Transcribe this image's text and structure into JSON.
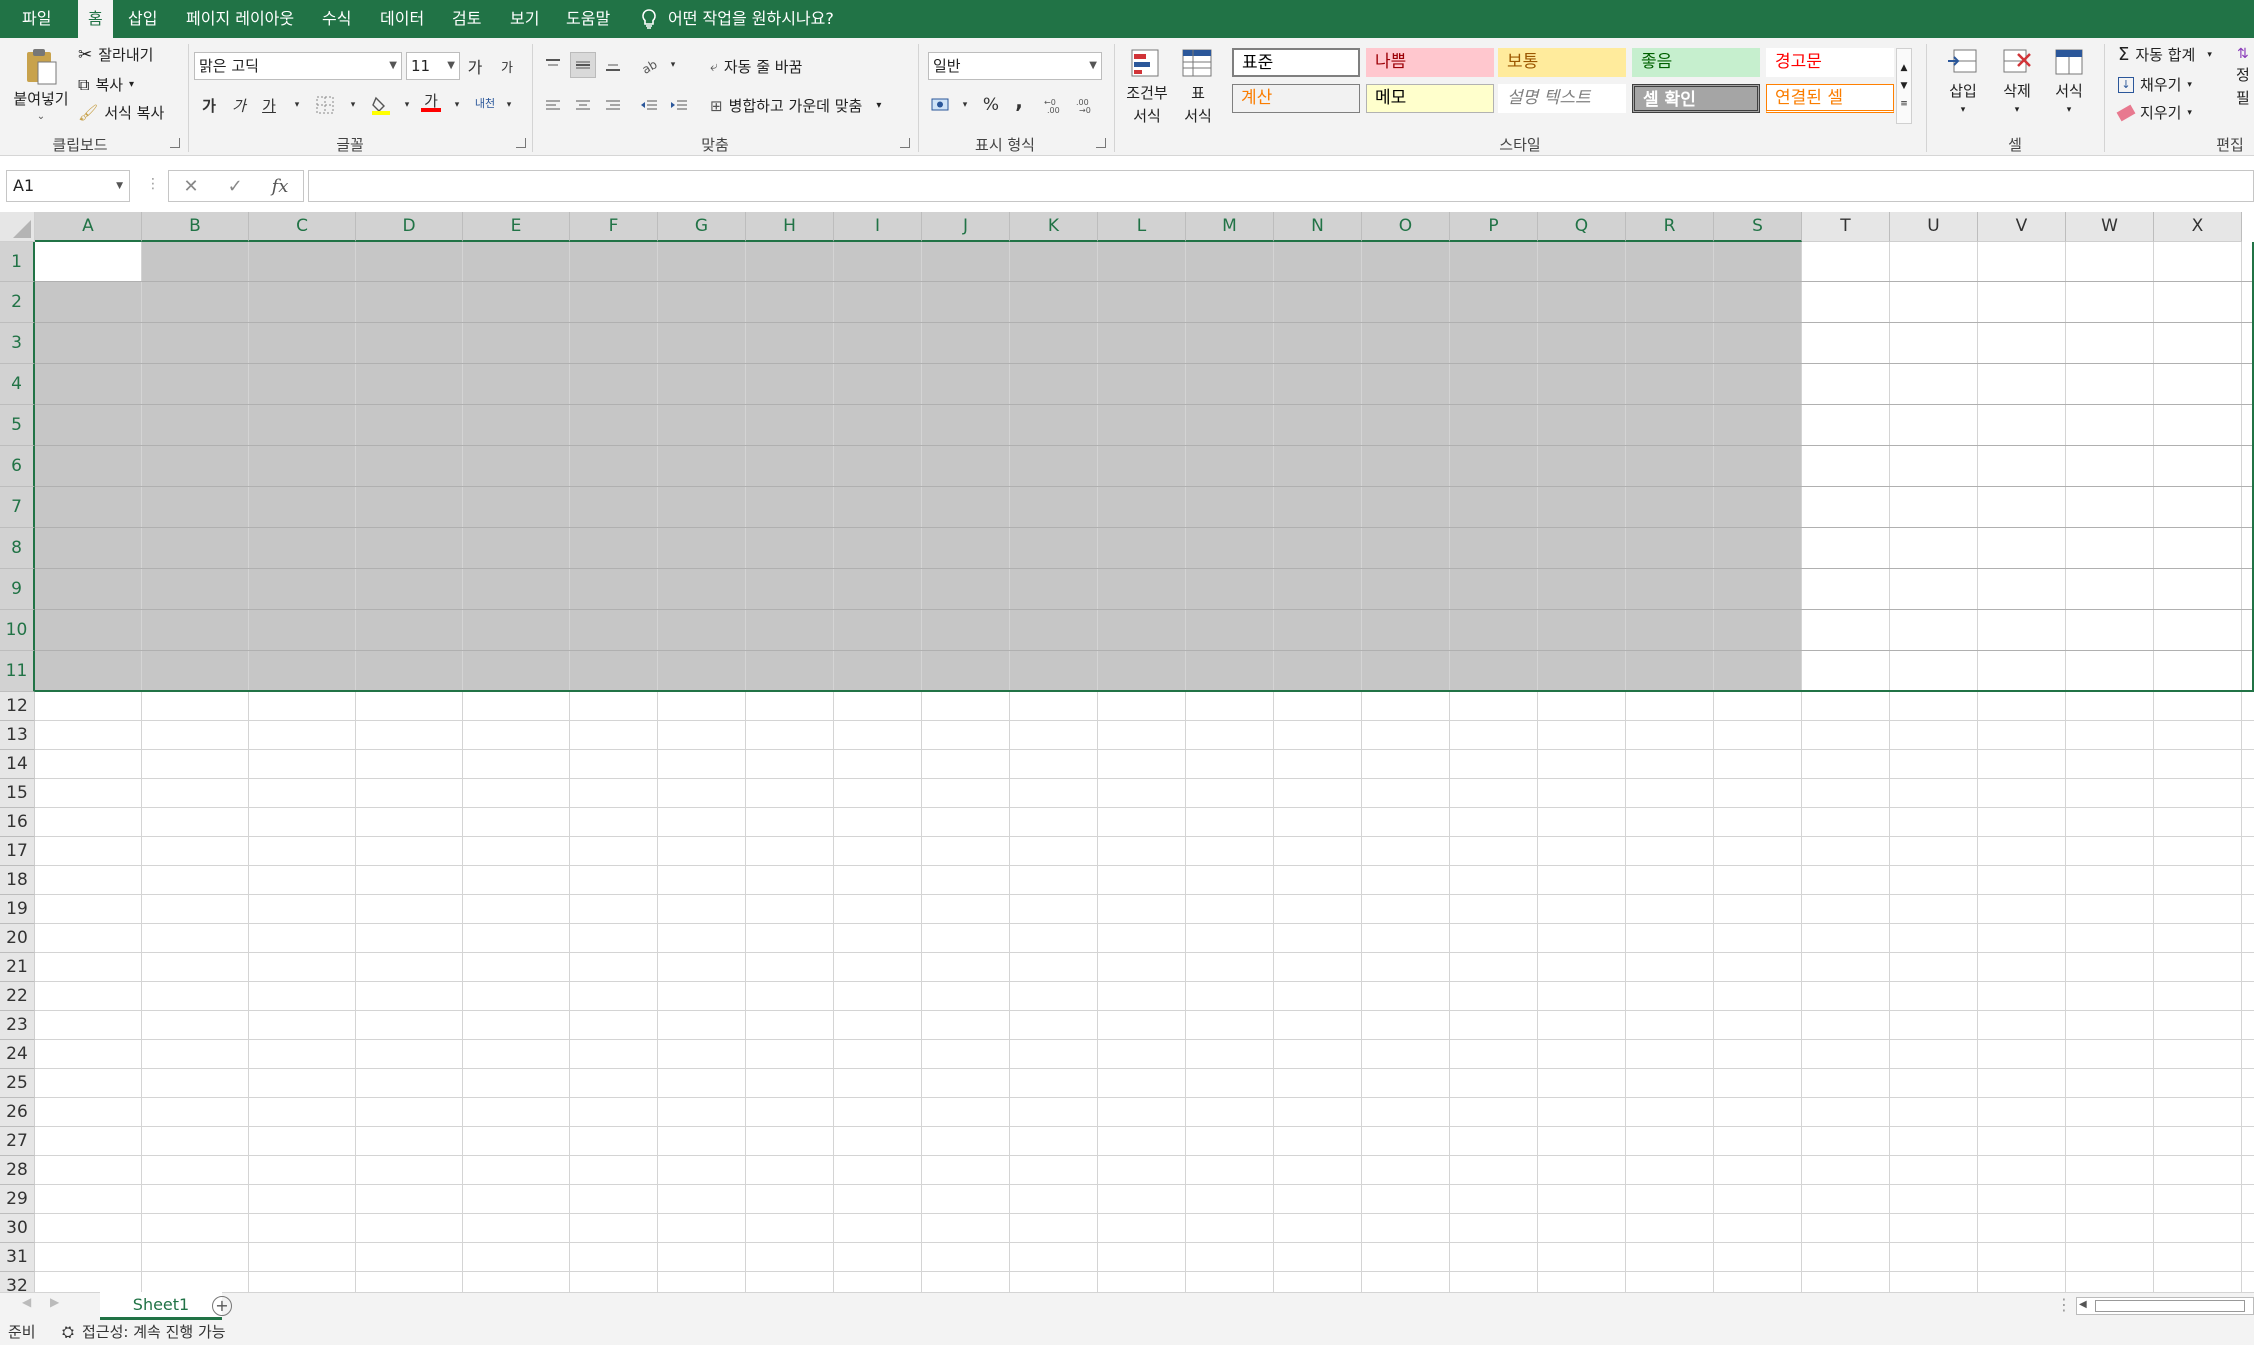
{
  "menu": {
    "tabs": [
      "파일",
      "홈",
      "삽입",
      "페이지 레이아웃",
      "수식",
      "데이터",
      "검토",
      "보기",
      "도움말"
    ],
    "tell_me": "어떤 작업을 원하시나요?"
  },
  "ribbon": {
    "clipboard": {
      "paste": "붙여넣기",
      "cut": "잘라내기",
      "copy": "복사",
      "format_painter": "서식 복사",
      "label": "클립보드"
    },
    "font": {
      "name": "맑은 고딕",
      "size": "11",
      "grow": "가",
      "shrink": "가",
      "bold": "가",
      "italic": "가",
      "underline": "가",
      "font_color": "가",
      "phonetic": "내천",
      "label": "글꼴"
    },
    "alignment": {
      "wrap_text": "자동 줄 바꿈",
      "merge_center": "병합하고 가운데 맞춤",
      "label": "맞춤"
    },
    "number": {
      "format": "일반",
      "percent": "%",
      "comma": ",",
      "label": "표시 형식"
    },
    "styles": {
      "conditional_format": [
        "조건부",
        "서식"
      ],
      "table_format": [
        "표",
        "서식"
      ],
      "cells": [
        {
          "text": "표준",
          "bg": "#ffffff",
          "fg": "#000000",
          "border": "#7f7f7f"
        },
        {
          "text": "나쁨",
          "bg": "#ffc7ce",
          "fg": "#9c0006",
          "border": "#ffc7ce"
        },
        {
          "text": "보통",
          "bg": "#ffeb9c",
          "fg": "#9c5700",
          "border": "#ffeb9c"
        },
        {
          "text": "좋음",
          "bg": "#c6efce",
          "fg": "#006100",
          "border": "#c6efce"
        },
        {
          "text": "경고문",
          "bg": "#ffffff",
          "fg": "#ff0000",
          "border": "#ffffff"
        },
        {
          "text": "계산",
          "bg": "#f2f2f2",
          "fg": "#fa7d00",
          "border": "#7f7f7f"
        },
        {
          "text": "메모",
          "bg": "#ffffcc",
          "fg": "#000000",
          "border": "#b2b2b2"
        },
        {
          "text": "설명 텍스트",
          "bg": "#ffffff",
          "fg": "#7f7f7f",
          "border": "#ffffff"
        },
        {
          "text": "셀 확인",
          "bg": "#a5a5a5",
          "fg": "#ffffff",
          "border": "#3f3f3f"
        },
        {
          "text": "연결된 셀",
          "bg": "#ffffff",
          "fg": "#fa7d00",
          "border": "#ff8001"
        }
      ],
      "label": "스타일"
    },
    "cells_group": {
      "insert": "삽입",
      "delete": "삭제",
      "format": "서식",
      "label": "셀"
    },
    "editing": {
      "autosum": "자동 합계",
      "fill": "채우기",
      "clear": "지우기",
      "sort_partial": "정",
      "filter_partial": "필",
      "label": "편집"
    }
  },
  "formula_bar": {
    "name_box": "A1",
    "cancel": "✕",
    "enter": "✓",
    "fx": "fx",
    "value": ""
  },
  "grid": {
    "columns": [
      "A",
      "B",
      "C",
      "D",
      "E",
      "F",
      "G",
      "H",
      "I",
      "J",
      "K",
      "L",
      "M",
      "N",
      "O",
      "P",
      "Q",
      "R",
      "S",
      "T",
      "U",
      "V",
      "W",
      "X"
    ],
    "rows": [
      "1",
      "2",
      "3",
      "4",
      "5",
      "6",
      "7",
      "8",
      "9",
      "10",
      "11",
      "12",
      "13",
      "14",
      "15",
      "16",
      "17",
      "18",
      "19",
      "20",
      "21",
      "22",
      "23",
      "24",
      "25",
      "26",
      "27",
      "28",
      "29",
      "30",
      "31",
      "32"
    ],
    "selected_rows": 11,
    "selected_columns": 19
  },
  "sheets": {
    "tabs": [
      "Sheet1"
    ]
  },
  "status": {
    "ready": "준비",
    "accessibility": "접근성: 계속 진행 가능"
  },
  "colors": {
    "accent": "#217346",
    "selection": "#c6c6c6"
  }
}
